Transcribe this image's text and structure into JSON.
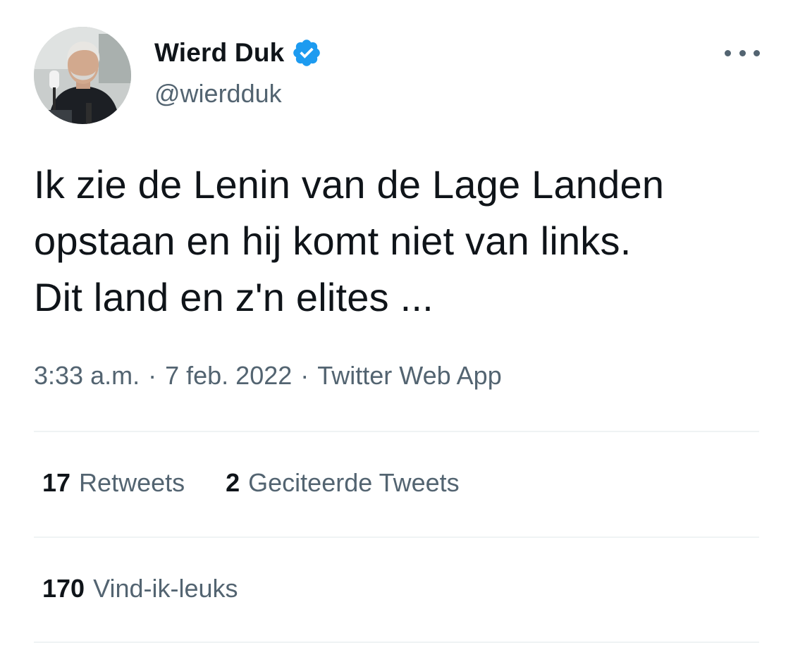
{
  "author": {
    "display_name": "Wierd Duk",
    "handle": "@wierdduk",
    "verified": true,
    "avatar_icon": "profile-photo"
  },
  "tweet": {
    "text": "Ik zie de Lenin van de Lage Landen\nopstaan en hij komt niet van links.\nDit land en z'n elites ..."
  },
  "meta": {
    "time": "3:33 a.m.",
    "separator": "·",
    "date": "7 feb. 2022",
    "source": "Twitter Web App"
  },
  "stats": {
    "retweets_count": "17",
    "retweets_label": "Retweets",
    "quotes_count": "2",
    "quotes_label": "Geciteerde Tweets",
    "likes_count": "170",
    "likes_label": "Vind-ik-leuks"
  },
  "colors": {
    "text_primary": "#0f1419",
    "text_secondary": "#536471",
    "verified_blue": "#1d9bf0",
    "divider": "#eff3f4"
  }
}
